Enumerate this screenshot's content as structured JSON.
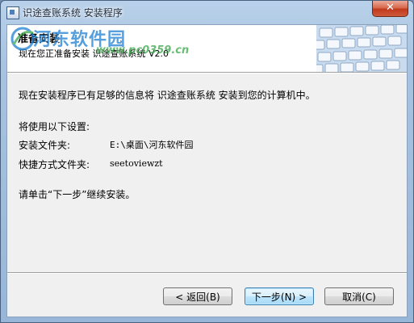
{
  "window": {
    "title": "识途查账系统 安装程序",
    "close_symbol": "✕"
  },
  "watermark": {
    "brand": "河东软件园",
    "url": "www.pc0359.cn"
  },
  "header": {
    "title": "准备安装",
    "subtitle": "现在您正准备安装 识途查账系统 V2.0"
  },
  "content": {
    "intro": "现在安装程序已有足够的信息将 识途查账系统 安装到您的计算机中。",
    "settings_heading": "将使用以下设置:",
    "install_folder_label": "安装文件夹:",
    "install_folder_value": "E:\\桌面\\河东软件园",
    "shortcut_folder_label": "快捷方式文件夹:",
    "shortcut_folder_value": "seetoviewzt",
    "next_instruction": "请单击“下一步”继续安装。"
  },
  "buttons": {
    "back": "< 返回(B)",
    "next": "下一步(N) >",
    "cancel": "取消(C)"
  },
  "colors": {
    "accent": "#3c7fb1",
    "close": "#c0391d",
    "watermark_blue": "#1e7fd4",
    "watermark_green": "#3aa64a"
  }
}
